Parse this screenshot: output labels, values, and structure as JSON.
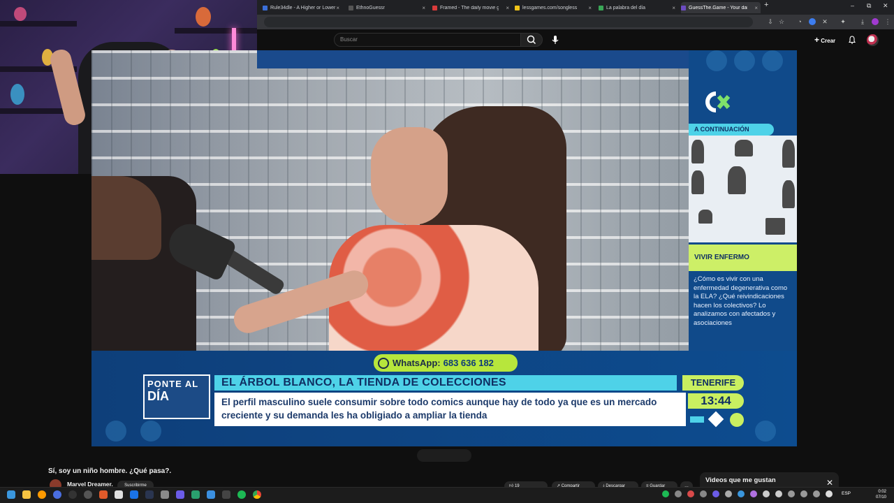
{
  "browser": {
    "tabs": [
      {
        "title": "Rule34dle - A Higher or Lower",
        "favicon_color": "#3b6fd8"
      },
      {
        "title": "EthnoGuessr",
        "favicon_color": "#555555"
      },
      {
        "title": "Framed - The daily movie guess",
        "favicon_color": "#d93b3b"
      },
      {
        "title": "lessgames.com/songless",
        "favicon_color": "#f0c419"
      },
      {
        "title": "La palabra del día",
        "favicon_color": "#3aa757"
      },
      {
        "title": "GuessThe.Game - Your daily vid",
        "favicon_color": "#6c4cc2"
      }
    ],
    "new_tab": "+",
    "window_controls": [
      "–",
      "⧉",
      "✕"
    ]
  },
  "youtube": {
    "search_placeholder": "Buscar",
    "create_label": "Crear",
    "icons": [
      "search-icon",
      "mic-icon",
      "bell-icon",
      "avatar"
    ]
  },
  "video": {
    "whatsapp_label": "WhatsApp:",
    "whatsapp_number": "683 636 182",
    "logo_line1": "PONTE AL",
    "logo_line2": "DÍA",
    "headline": "EL ÁRBOL BLANCO, LA TIENDA DE COLECCIONES",
    "subline": "El perfil masculino suele consumir sobre todo comics aunque hay de todo ya que es un mercado creciente y su demanda les ha obligiado a ampliar la tienda",
    "location": "TENERIFE",
    "clock": "13:44",
    "next_label": "A CONTINUACIÓN",
    "program_title": "VIVIR ENFERMO",
    "program_desc": "¿Cómo es vivir con una enfermedad degenerativa como la ELA? ¿Qué reivindicaciones hacen los colectivos? Lo analizamos con afectados y asociaciones",
    "accent_colors": {
      "cyan": "#4ed2e8",
      "lime": "#c9ef60",
      "navy": "#0d4c8f"
    }
  },
  "below_video": {
    "caption": "Sí, soy un niño hombre. ¿Qué pasa?.",
    "channel_name": "Marvel Dreamer.",
    "subscribe_label": "Suscribirme",
    "likes": "19",
    "share_label": "Compartir",
    "thanks_label": "Descargar",
    "save_label": "Guardar",
    "side_panel_title": "Videos que me gustan"
  },
  "taskbar": {
    "language": "ESP",
    "time": "0:02",
    "date": "07/10"
  }
}
